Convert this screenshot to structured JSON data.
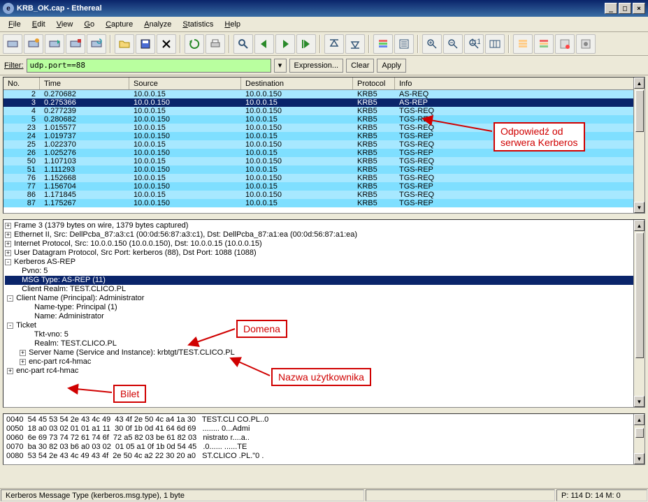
{
  "title": "KRB_OK.cap - Ethereal",
  "menu": {
    "file": "File",
    "edit": "Edit",
    "view": "View",
    "go": "Go",
    "capture": "Capture",
    "analyze": "Analyze",
    "statistics": "Statistics",
    "help": "Help"
  },
  "filter": {
    "label": "Filter:",
    "value": "udp.port==88",
    "expression": "Expression...",
    "clear": "Clear",
    "apply": "Apply"
  },
  "columns": {
    "no": "No. ",
    "time": "Time",
    "source": "Source",
    "destination": "Destination",
    "protocol": "Protocol",
    "info": "Info"
  },
  "packets": [
    {
      "no": "2",
      "time": "0.270682",
      "src": "10.0.0.15",
      "dst": "10.0.0.150",
      "proto": "KRB5",
      "info": "AS-REQ",
      "sel": false
    },
    {
      "no": "3",
      "time": "0.275366",
      "src": "10.0.0.150",
      "dst": "10.0.0.15",
      "proto": "KRB5",
      "info": "AS-REP",
      "sel": true
    },
    {
      "no": "4",
      "time": "0.277239",
      "src": "10.0.0.15",
      "dst": "10.0.0.150",
      "proto": "KRB5",
      "info": "TGS-REQ",
      "sel": false
    },
    {
      "no": "5",
      "time": "0.280682",
      "src": "10.0.0.150",
      "dst": "10.0.0.15",
      "proto": "KRB5",
      "info": "TGS-REP",
      "sel": false
    },
    {
      "no": "23",
      "time": "1.015577",
      "src": "10.0.0.15",
      "dst": "10.0.0.150",
      "proto": "KRB5",
      "info": "TGS-REQ",
      "sel": false
    },
    {
      "no": "24",
      "time": "1.019737",
      "src": "10.0.0.150",
      "dst": "10.0.0.15",
      "proto": "KRB5",
      "info": "TGS-REP",
      "sel": false
    },
    {
      "no": "25",
      "time": "1.022370",
      "src": "10.0.0.15",
      "dst": "10.0.0.150",
      "proto": "KRB5",
      "info": "TGS-REQ",
      "sel": false
    },
    {
      "no": "26",
      "time": "1.025276",
      "src": "10.0.0.150",
      "dst": "10.0.0.15",
      "proto": "KRB5",
      "info": "TGS-REP",
      "sel": false
    },
    {
      "no": "50",
      "time": "1.107103",
      "src": "10.0.0.15",
      "dst": "10.0.0.150",
      "proto": "KRB5",
      "info": "TGS-REQ",
      "sel": false
    },
    {
      "no": "51",
      "time": "1.111293",
      "src": "10.0.0.150",
      "dst": "10.0.0.15",
      "proto": "KRB5",
      "info": "TGS-REP",
      "sel": false
    },
    {
      "no": "76",
      "time": "1.152668",
      "src": "10.0.0.15",
      "dst": "10.0.0.150",
      "proto": "KRB5",
      "info": "TGS-REQ",
      "sel": false
    },
    {
      "no": "77",
      "time": "1.156704",
      "src": "10.0.0.150",
      "dst": "10.0.0.15",
      "proto": "KRB5",
      "info": "TGS-REP",
      "sel": false
    },
    {
      "no": "86",
      "time": "1.171845",
      "src": "10.0.0.15",
      "dst": "10.0.0.150",
      "proto": "KRB5",
      "info": "TGS-REQ",
      "sel": false
    },
    {
      "no": "87",
      "time": "1.175267",
      "src": "10.0.0.150",
      "dst": "10.0.0.15",
      "proto": "KRB5",
      "info": "TGS-REP",
      "sel": false
    }
  ],
  "details": {
    "frame": "Frame 3 (1379 bytes on wire, 1379 bytes captured)",
    "eth": "Ethernet II, Src: DellPcba_87:a3:c1 (00:0d:56:87:a3:c1), Dst: DellPcba_87:a1:ea (00:0d:56:87:a1:ea)",
    "ip": "Internet Protocol, Src: 10.0.0.150 (10.0.0.150), Dst: 10.0.0.15 (10.0.0.15)",
    "udp": "User Datagram Protocol, Src Port: kerberos (88), Dst Port: 1088 (1088)",
    "krb": "Kerberos AS-REP",
    "pvno": "Pvno: 5",
    "msgtype": "MSG Type: AS-REP (11)",
    "crealm": "Client Realm: TEST.CLICO.PL",
    "cname": "Client Name (Principal): Administrator",
    "nametype": "Name-type: Principal (1)",
    "name": "Name: Administrator",
    "ticket": "Ticket",
    "tktvno": "Tkt-vno: 5",
    "realm": "Realm: TEST.CLICO.PL",
    "sname": "Server Name (Service and Instance): krbtgt/TEST.CLICO.PL",
    "enc1": "enc-part rc4-hmac",
    "enc2": "enc-part rc4-hmac"
  },
  "hex": [
    {
      "off": "0040",
      "bytes": "54 45 53 54 2e 43 4c 49  43 4f 2e 50 4c a4 1a 30",
      "asc": "TEST.CLI CO.PL..0"
    },
    {
      "off": "0050",
      "bytes": "18 a0 03 02 01 01 a1 11  30 0f 1b 0d 41 64 6d 69",
      "asc": "........ 0...Admi"
    },
    {
      "off": "0060",
      "bytes": "6e 69 73 74 72 61 74 6f  72 a5 82 03 be 61 82 03",
      "asc": "nistrato r....a.."
    },
    {
      "off": "0070",
      "bytes": "ba 30 82 03 b6 a0 03 02  01 05 a1 0f 1b 0d 54 45",
      "asc": ".0...... ......TE"
    },
    {
      "off": "0080",
      "bytes": "53 54 2e 43 4c 49 43 4f  2e 50 4c a2 22 30 20 a0",
      "asc": "ST.CLICO .PL.\"0 ."
    }
  ],
  "status": {
    "left": "Kerberos Message Type (kerberos.msg.type), 1 byte",
    "mid": "",
    "right": "P: 114 D: 14 M: 0"
  },
  "annotations": {
    "reply": "Odpowiedź od\nserwera Kerberos",
    "domain": "Domena",
    "user": "Nazwa użytkownika",
    "ticket": "Bilet"
  }
}
